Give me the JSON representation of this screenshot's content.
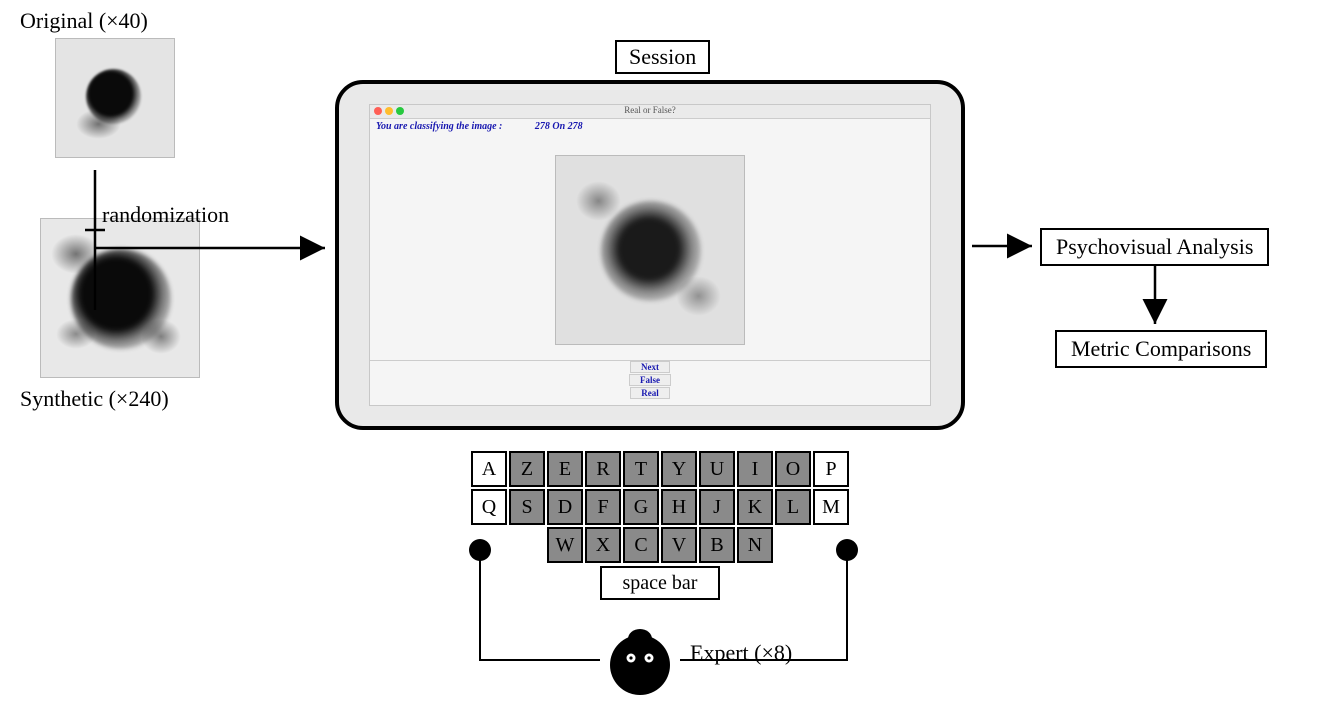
{
  "labels": {
    "original": "Original (×40)",
    "synthetic": "Synthetic (×240)",
    "randomization": "randomization",
    "session": "Session",
    "space_bar": "space bar",
    "expert": "Expert (×8)",
    "psychovisual": "Psychovisual Analysis",
    "metric": "Metric Comparisons"
  },
  "session_window": {
    "title": "Real or False?",
    "status_prefix": "You are classifying the image :",
    "status_count": "278 On 278",
    "buttons": {
      "next": "Next",
      "false": "False",
      "real": "Real"
    }
  },
  "keyboard": {
    "row1": [
      "A",
      "Z",
      "E",
      "R",
      "T",
      "Y",
      "U",
      "I",
      "O",
      "P"
    ],
    "row2": [
      "Q",
      "S",
      "D",
      "F",
      "G",
      "H",
      "J",
      "K",
      "L",
      "M"
    ],
    "row3": [
      "W",
      "X",
      "C",
      "V",
      "B",
      "N"
    ],
    "white_keys": [
      "A",
      "P",
      "Q",
      "M"
    ]
  }
}
